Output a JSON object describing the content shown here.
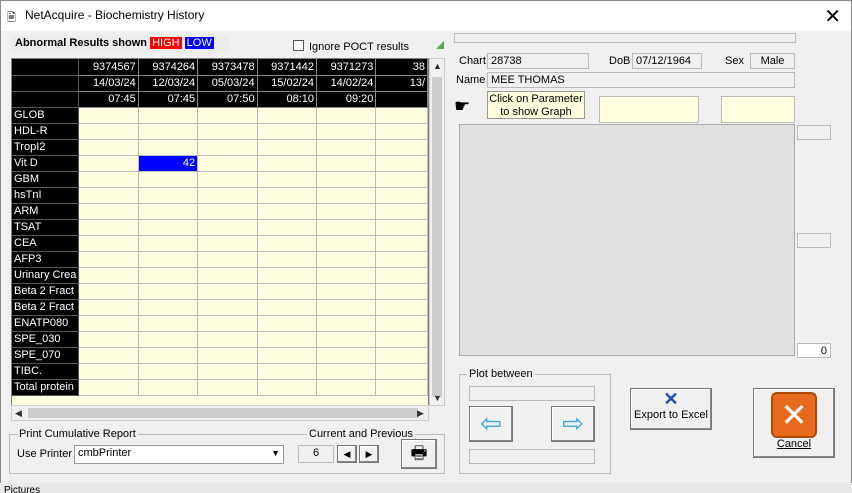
{
  "window": {
    "title": "NetAcquire - Biochemistry History",
    "close_glyph": "✕"
  },
  "legend": {
    "label": "Abnormal Results shown",
    "high": "HIGH",
    "low": "LOW"
  },
  "poct": {
    "label": "Ignore POCT results"
  },
  "grid": {
    "headers": {
      "ids": [
        "9374567",
        "9374264",
        "9373478",
        "9371442",
        "9371273",
        "38"
      ],
      "dates": [
        "14/03/24",
        "12/03/24",
        "05/03/24",
        "15/02/24",
        "14/02/24",
        "13/"
      ],
      "times": [
        "07:45",
        "07:45",
        "07:50",
        "08:10",
        "09:20",
        ""
      ]
    },
    "rows": [
      "GLOB",
      "HDL-R",
      "TropI2",
      "Vit D",
      "GBM",
      "hsTnI",
      "ARM",
      "TSAT",
      "CEA",
      "AFP3",
      "Urinary Crea",
      "Beta 2 Fract",
      "Beta 2 Fract",
      "ENATP080",
      "SPE_030",
      "SPE_070",
      "TIBC.",
      "Total protein"
    ],
    "vitd_value": "42"
  },
  "print": {
    "group_label": "Print Cumulative Report",
    "printer_label": "Use Printer",
    "printer_value": "cmbPrinter",
    "current_previous_label": "Current and Previous",
    "count": "6"
  },
  "patient": {
    "chart_label": "Chart",
    "chart": "28738",
    "dob_label": "DoB",
    "dob": "07/12/1964",
    "sex_label": "Sex",
    "sex": "Male",
    "name_label": "Name",
    "name": "MEE THOMAS"
  },
  "graph_hint": "Click on Parameter to show Graph",
  "graph_counter": "0",
  "plot": {
    "label": "Plot between"
  },
  "buttons": {
    "export": "Export to Excel",
    "cancel": "Cancel"
  },
  "background_text": "Pictures"
}
